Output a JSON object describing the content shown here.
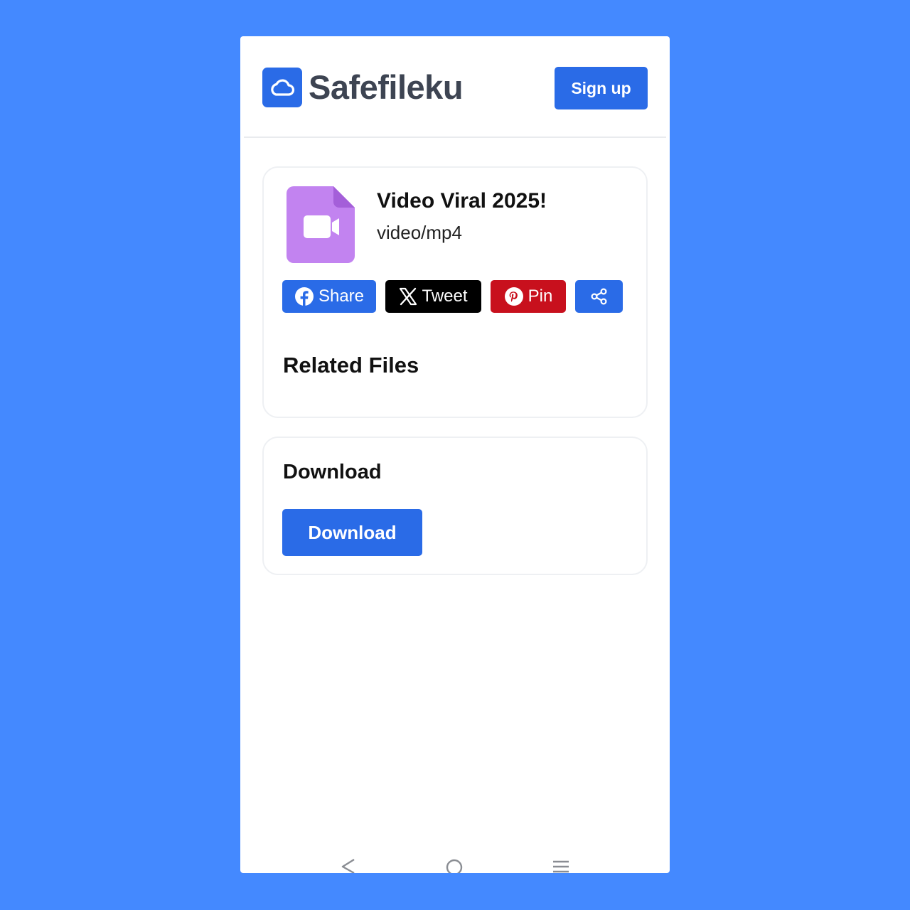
{
  "header": {
    "brand": "Safefileku",
    "logo_icon": "cloud-icon",
    "signup_label": "Sign up"
  },
  "file": {
    "title": "Video Viral 2025!",
    "type": "video/mp4",
    "icon": "video-file-icon"
  },
  "share": {
    "facebook_label": "Share",
    "x_label": "Tweet",
    "pinterest_label": "Pin",
    "more_icon": "share-icon"
  },
  "related": {
    "title": "Related Files"
  },
  "download": {
    "title": "Download",
    "button_label": "Download"
  },
  "nav": {
    "items": [
      "back-icon",
      "home-icon",
      "menu-icon"
    ]
  },
  "colors": {
    "background": "#4489ff",
    "primary": "#2a6be7",
    "x": "#000000",
    "pinterest": "#c8101d",
    "file_icon": "#c283f0"
  }
}
